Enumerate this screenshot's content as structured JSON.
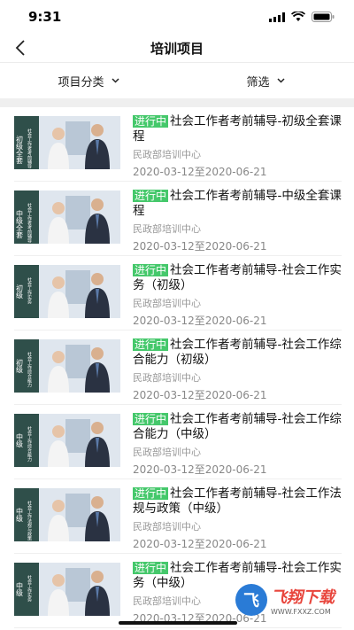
{
  "status": {
    "time": "9:31"
  },
  "nav": {
    "title": "培训项目"
  },
  "filters": {
    "category": "项目分类",
    "filter": "筛选"
  },
  "courses": [
    {
      "badge": "进行中",
      "title": "社会工作者考前辅导-初级全套课程",
      "org": "民政部培训中心",
      "date": "2020-03-12至2020-06-21",
      "thumb_tag": "初级全套",
      "thumb_side": "社会工作者考前辅导"
    },
    {
      "badge": "进行中",
      "title": "社会工作者考前辅导-中级全套课程",
      "org": "民政部培训中心",
      "date": "2020-03-12至2020-06-21",
      "thumb_tag": "中级全套",
      "thumb_side": "社会工作者考前辅导"
    },
    {
      "badge": "进行中",
      "title": "社会工作者考前辅导-社会工作实务（初级）",
      "org": "民政部培训中心",
      "date": "2020-03-12至2020-06-21",
      "thumb_tag": "初级",
      "thumb_side": "社会工作实务"
    },
    {
      "badge": "进行中",
      "title": "社会工作者考前辅导-社会工作综合能力（初级）",
      "org": "民政部培训中心",
      "date": "2020-03-12至2020-06-21",
      "thumb_tag": "初级",
      "thumb_side": "社会工作综合能力"
    },
    {
      "badge": "进行中",
      "title": "社会工作者考前辅导-社会工作综合能力（中级）",
      "org": "民政部培训中心",
      "date": "2020-03-12至2020-06-21",
      "thumb_tag": "中级",
      "thumb_side": "社会工作综合能力"
    },
    {
      "badge": "进行中",
      "title": "社会工作者考前辅导-社会工作法规与政策（中级）",
      "org": "民政部培训中心",
      "date": "2020-03-12至2020-06-21",
      "thumb_tag": "中级",
      "thumb_side": "社会工作法规与政策"
    },
    {
      "badge": "进行中",
      "title": "社会工作者考前辅导-社会工作实务（中级）",
      "org": "民政部培训中心",
      "date": "2020-03-12至2020-06-21",
      "thumb_tag": "中级",
      "thumb_side": "社会工作实务"
    }
  ],
  "watermark": {
    "logo": "飞",
    "main": "飞翔下载",
    "sub": "WWW.FXXZ.COM"
  },
  "colors": {
    "badge": "#45c86b",
    "thumb_bg": "#dfe6ee"
  }
}
